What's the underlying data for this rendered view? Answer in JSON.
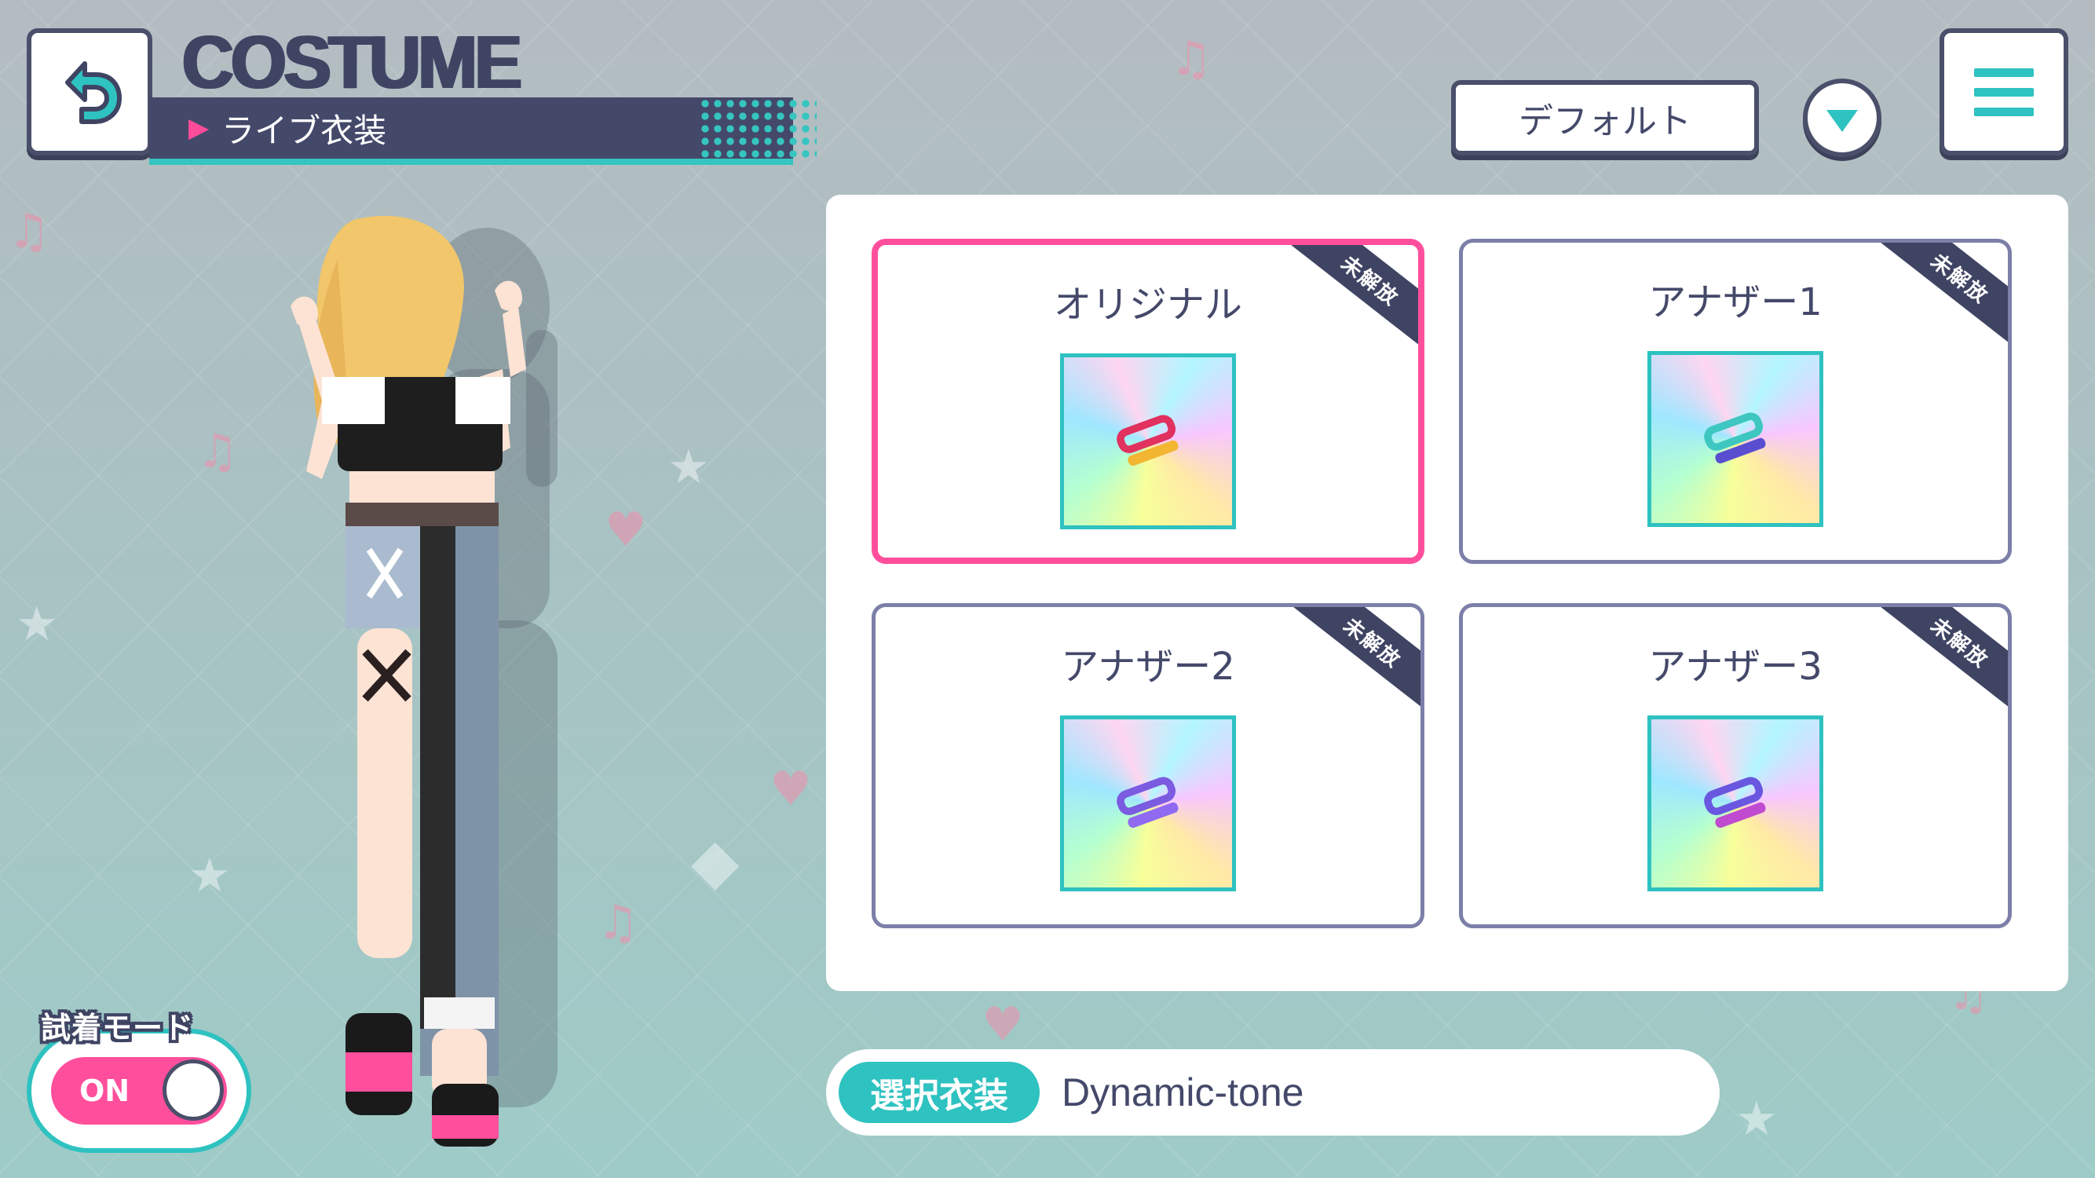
{
  "header": {
    "title": "COSTUME",
    "subtitle": "ライブ衣装",
    "back_icon": "back-arrow-icon"
  },
  "filter": {
    "selected": "デフォルト"
  },
  "menu": {
    "icon": "hamburger-menu-icon"
  },
  "costumes": [
    {
      "label": "オリジナル",
      "badge": "未解放",
      "selected": true,
      "accent": "#e0315f"
    },
    {
      "label": "アナザー1",
      "badge": "未解放",
      "selected": false,
      "accent": "#3ec7c0"
    },
    {
      "label": "アナザー2",
      "badge": "未解放",
      "selected": false,
      "accent": "#7b5be0"
    },
    {
      "label": "アナザー3",
      "badge": "未解放",
      "selected": false,
      "accent": "#6a57e0"
    }
  ],
  "try_on": {
    "label": "試着モード",
    "state": "ON"
  },
  "selected_costume": {
    "tag": "選択衣装",
    "name": "Dynamic-tone"
  },
  "colors": {
    "accent_teal": "#2ec2c0",
    "accent_pink": "#ff4f9c",
    "navy": "#44496a"
  }
}
